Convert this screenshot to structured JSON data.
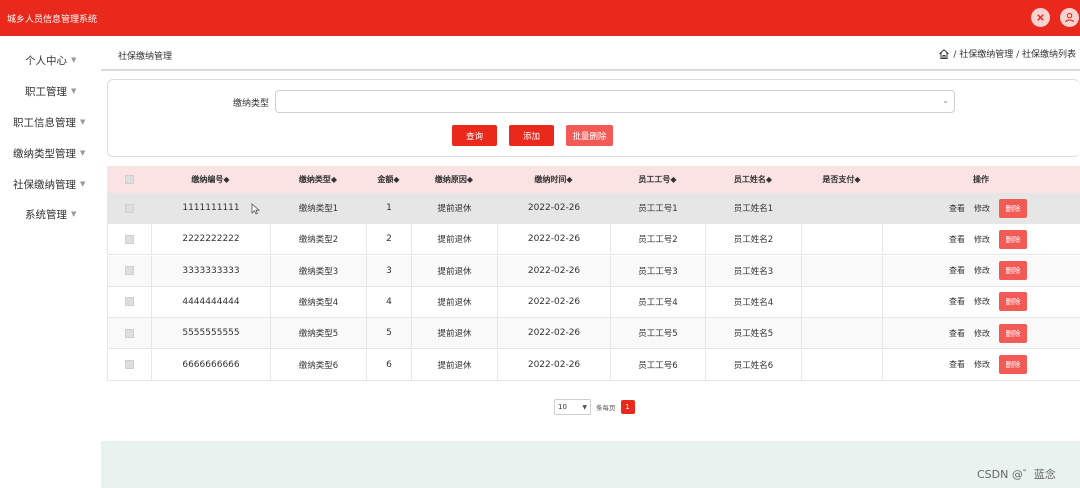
{
  "app": {
    "title": "城乡人员信息管理系统"
  },
  "sidebar": {
    "items": [
      {
        "label": "个人中心"
      },
      {
        "label": "职工管理"
      },
      {
        "label": "职工信息管理"
      },
      {
        "label": "缴纳类型管理"
      },
      {
        "label": "社保缴纳管理"
      },
      {
        "label": "系统管理"
      }
    ]
  },
  "header": {
    "title": "社保缴纳管理",
    "breadcrumb": "/ 社保缴纳管理 / 社保缴纳列表"
  },
  "search": {
    "label": "缴纳类型",
    "value": "",
    "query_btn": "查询",
    "add_btn": "添加",
    "batch_delete_btn": "批量删除"
  },
  "table": {
    "columns": [
      "缴纳编号◆",
      "缴纳类型◆",
      "金额◆",
      "缴纳原因◆",
      "缴纳时间◆",
      "员工工号◆",
      "员工姓名◆",
      "是否支付◆",
      "操作"
    ],
    "rows": [
      {
        "id": "1111111111",
        "type": "缴纳类型1",
        "amount": "1",
        "reason": "提前退休",
        "time": "2022-02-26",
        "emp_no": "员工工号1",
        "emp_name": "员工姓名1",
        "paid": ""
      },
      {
        "id": "2222222222",
        "type": "缴纳类型2",
        "amount": "2",
        "reason": "提前退休",
        "time": "2022-02-26",
        "emp_no": "员工工号2",
        "emp_name": "员工姓名2",
        "paid": ""
      },
      {
        "id": "3333333333",
        "type": "缴纳类型3",
        "amount": "3",
        "reason": "提前退休",
        "time": "2022-02-26",
        "emp_no": "员工工号3",
        "emp_name": "员工姓名3",
        "paid": ""
      },
      {
        "id": "4444444444",
        "type": "缴纳类型4",
        "amount": "4",
        "reason": "提前退休",
        "time": "2022-02-26",
        "emp_no": "员工工号4",
        "emp_name": "员工姓名4",
        "paid": ""
      },
      {
        "id": "5555555555",
        "type": "缴纳类型5",
        "amount": "5",
        "reason": "提前退休",
        "time": "2022-02-26",
        "emp_no": "员工工号5",
        "emp_name": "员工姓名5",
        "paid": ""
      },
      {
        "id": "6666666666",
        "type": "缴纳类型6",
        "amount": "6",
        "reason": "提前退休",
        "time": "2022-02-26",
        "emp_no": "员工工号6",
        "emp_name": "员工姓名6",
        "paid": ""
      }
    ],
    "actions": {
      "view": "查看",
      "edit": "修改",
      "delete": "删除"
    }
  },
  "pagination": {
    "page_size": "10",
    "per_page_label": "条每页",
    "current_page": "1"
  },
  "watermark": "CSDN @゛蓝念",
  "colors": {
    "brand": "#e8291c",
    "delete": "#f25a56",
    "header_row": "#fbe3e3",
    "footer": "#e8f3ef"
  }
}
